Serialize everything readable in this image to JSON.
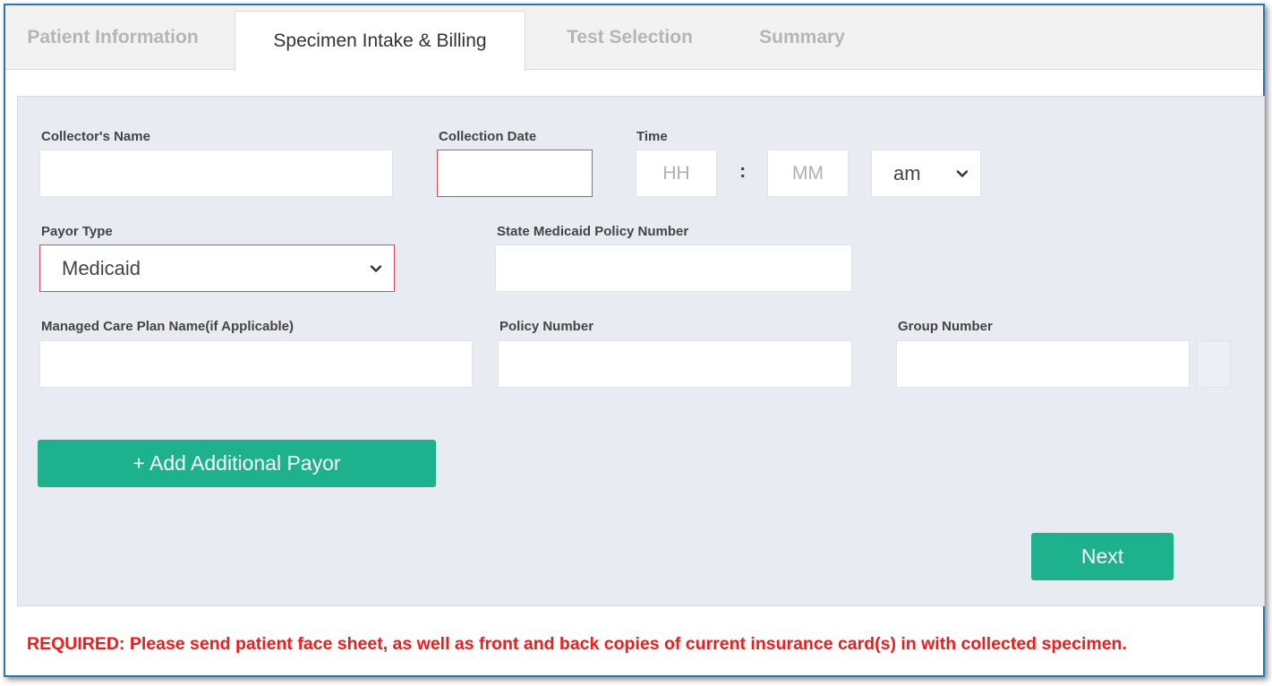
{
  "tabs": [
    {
      "label": "Patient Information"
    },
    {
      "label": "Specimen Intake & Billing"
    },
    {
      "label": "Test Selection"
    },
    {
      "label": "Summary"
    }
  ],
  "form": {
    "collector_name_label": "Collector's Name",
    "collector_name_value": "",
    "collection_date_label": "Collection Date",
    "collection_date_value": "",
    "time_label": "Time",
    "hour_placeholder": "HH",
    "minute_placeholder": "MM",
    "time_separator": ":",
    "ampm_value": "am",
    "payor_type_label": "Payor Type",
    "payor_type_value": "Medicaid",
    "state_medicaid_label": "State Medicaid Policy Number",
    "state_medicaid_value": "",
    "managed_care_label": "Managed Care Plan Name(if Applicable)",
    "managed_care_value": "",
    "policy_number_label": "Policy Number",
    "policy_number_value": "",
    "group_number_label": "Group Number",
    "group_number_value": "",
    "add_payor_label": "+ Add Additional Payor",
    "next_label": "Next"
  },
  "required_notice": "REQUIRED: Please send patient face sheet, as well as front and back copies of current insurance card(s) in with collected specimen.",
  "colors": {
    "accent": "#1db28d",
    "error_border": "#e0485a",
    "required_text": "#ee1c1c",
    "frame_border": "#2e75b6",
    "panel_bg": "#e8ebf1"
  },
  "icons": {
    "select_caret": "chevron-down-icon"
  }
}
